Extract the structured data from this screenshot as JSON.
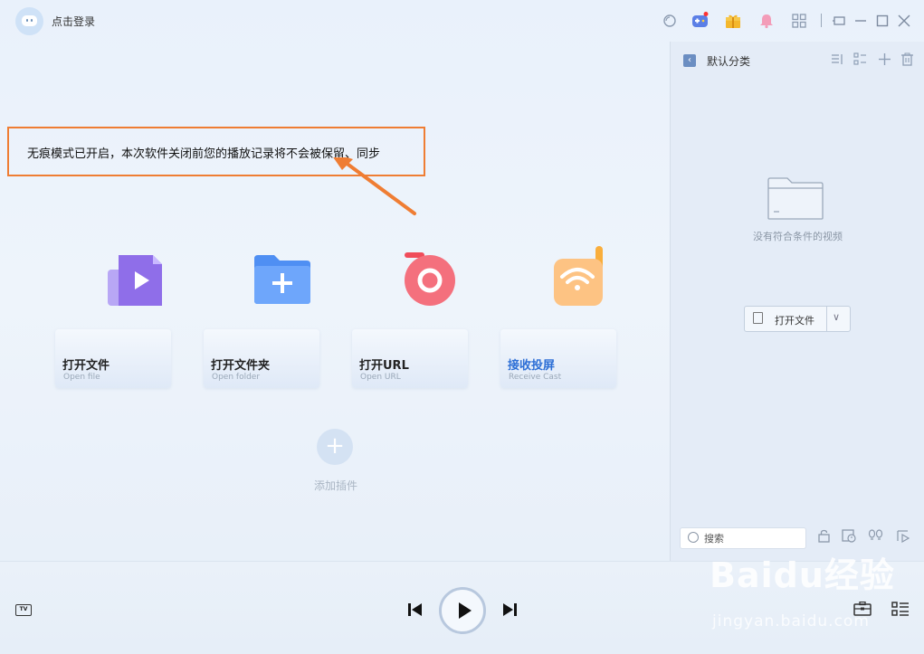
{
  "titlebar": {
    "login_label": "点击登录",
    "icons": [
      "search-icon",
      "game-icon",
      "gift-icon",
      "bell-icon",
      "apps-icon",
      "mini-mode-icon",
      "minimize-icon",
      "maximize-icon",
      "close-icon"
    ]
  },
  "notice": {
    "text": "无痕模式已开启，本次软件关闭前您的播放记录将不会被保留、同步"
  },
  "actions": [
    {
      "title": "打开文件",
      "subtitle": "Open file"
    },
    {
      "title": "打开文件夹",
      "subtitle": "Open folder"
    },
    {
      "title": "打开URL",
      "subtitle": "Open URL"
    },
    {
      "title": "接收投屏",
      "subtitle": "Receive Cast"
    }
  ],
  "add_plugin_label": "添加插件",
  "sidebar": {
    "category": "默认分类",
    "empty_text": "没有符合条件的视频",
    "open_file_label": "打开文件",
    "search_placeholder": "搜索"
  },
  "player": {
    "tv_label": "TV"
  },
  "watermark": {
    "main": "Baidu经验",
    "sub": "jingyan.baidu.com"
  },
  "colors": {
    "accent": "#ef7d33",
    "receive_cast_title": "#2d6fd6"
  }
}
